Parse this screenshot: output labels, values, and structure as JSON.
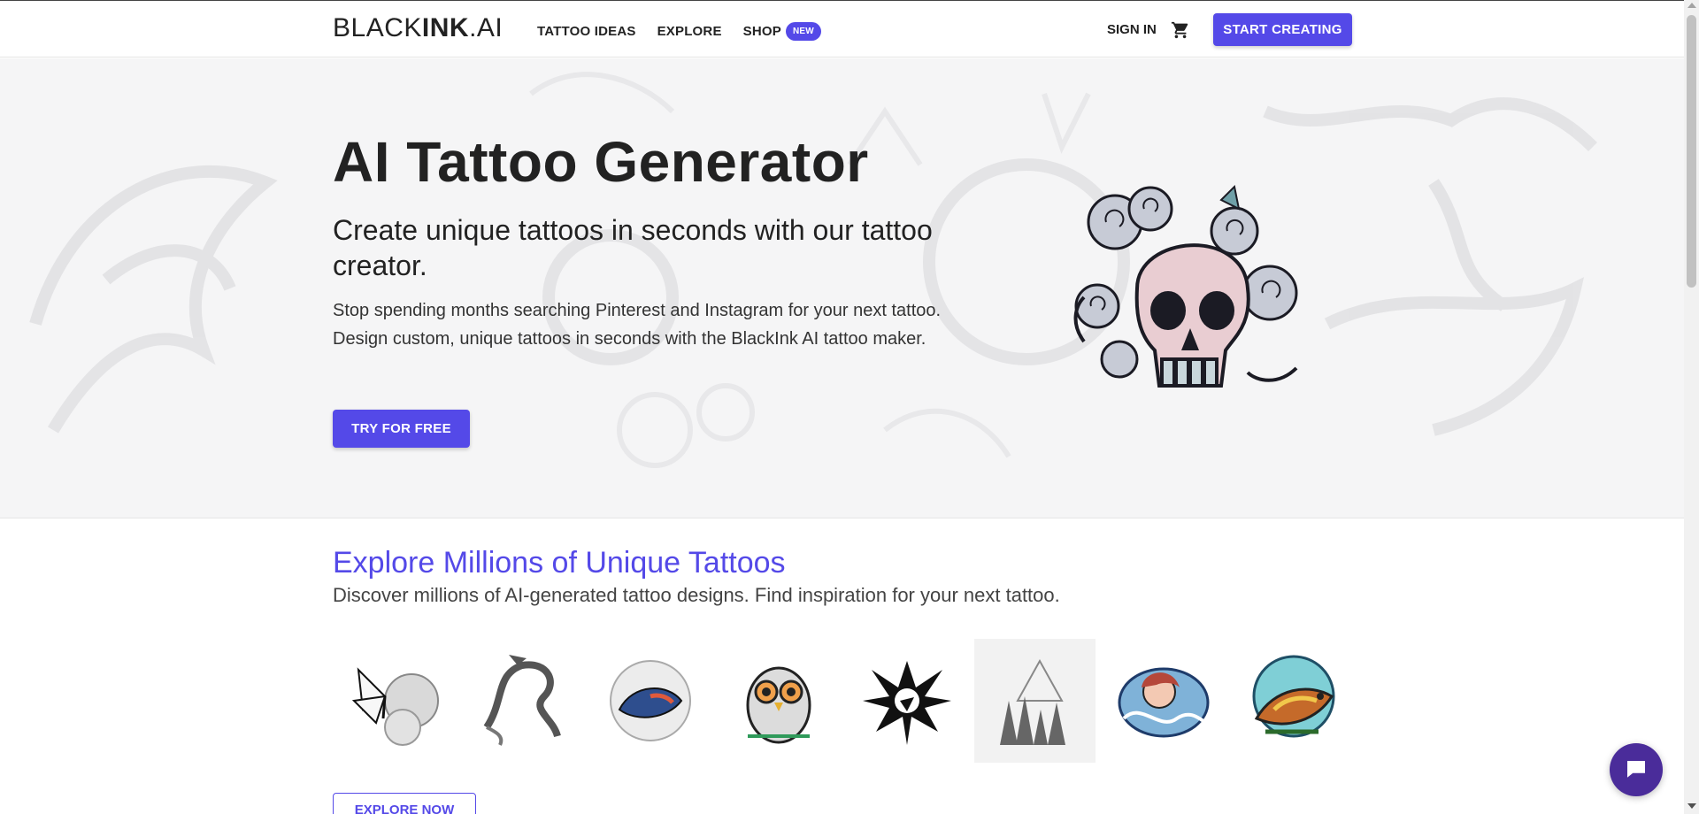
{
  "header": {
    "logo_light": "BLACK",
    "logo_bold": "INK",
    "logo_tail": ".AI",
    "nav": [
      {
        "label": "TATTOO IDEAS"
      },
      {
        "label": "EXPLORE"
      },
      {
        "label": "SHOP",
        "badge": "NEW"
      }
    ],
    "signin_label": "SIGN IN",
    "cart_icon": "cart-icon",
    "start_label": "START CREATING"
  },
  "hero": {
    "title": "AI Tattoo Generator",
    "subtitle": "Create unique tattoos in seconds with our tattoo creator.",
    "description": "Stop spending months searching Pinterest and Instagram for your next tattoo. Design custom, unique tattoos in seconds with the BlackInk AI tattoo maker.",
    "cta_label": "TRY FOR FREE",
    "art_icon": "skull-roses-tattoo"
  },
  "explore": {
    "title": "Explore Millions of Unique Tattoos",
    "subtitle": "Discover millions of AI-generated tattoo designs. Find inspiration for your next tattoo.",
    "gallery": [
      {
        "icon": "butterfly-roses-tattoo"
      },
      {
        "icon": "dragon-tattoo"
      },
      {
        "icon": "koi-fish-tattoo"
      },
      {
        "icon": "owl-tattoo"
      },
      {
        "icon": "tribal-eagle-tattoo"
      },
      {
        "icon": "mountain-forest-tattoo"
      },
      {
        "icon": "mermaid-wave-tattoo"
      },
      {
        "icon": "sparrow-tattoo"
      }
    ],
    "button_label": "EXPLORE NOW"
  },
  "chat": {
    "icon": "chat-bubble-icon"
  },
  "colors": {
    "accent": "#5449e8",
    "chat": "#4a2c9a",
    "hero_bg": "#f5f5f6"
  }
}
